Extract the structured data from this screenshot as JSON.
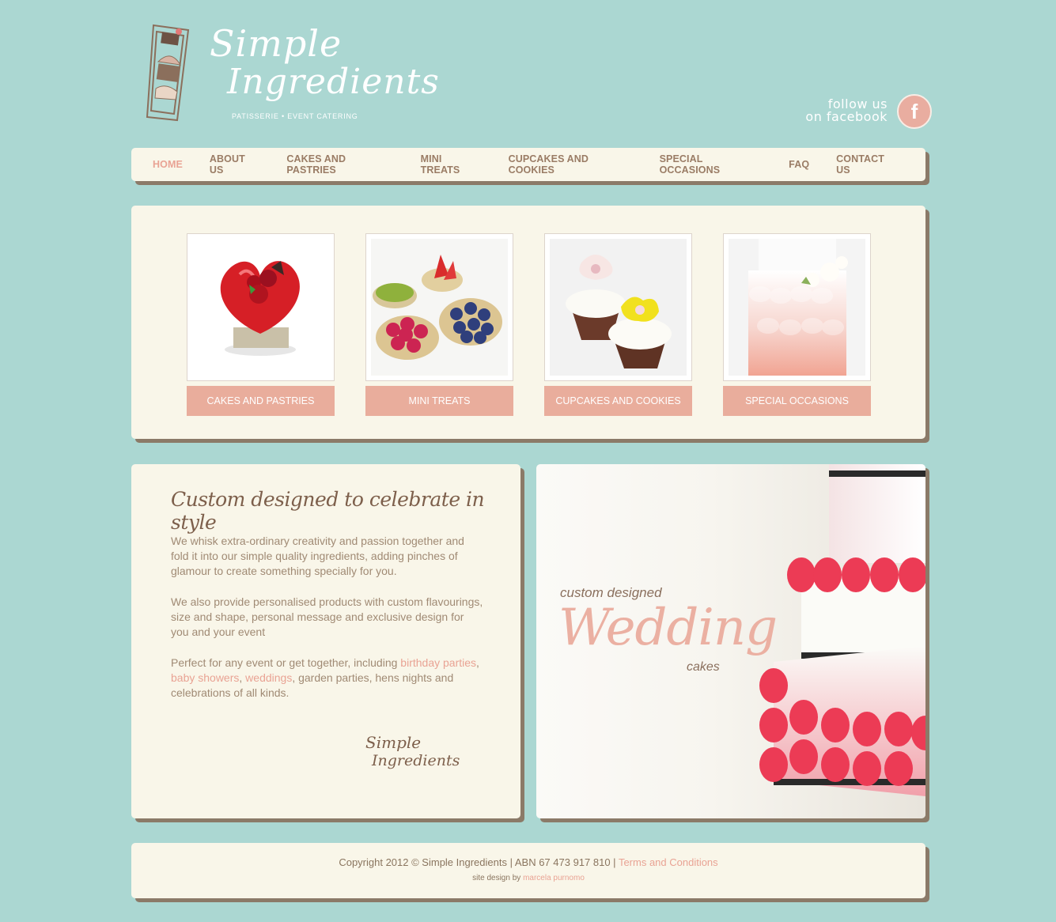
{
  "brand": {
    "name_line1": "Simple",
    "name_line2": "Ingredients",
    "tagline": "PATISSERIE • EVENT CATERING",
    "colors": {
      "background": "#abd7d2",
      "card": "#f9f6e9",
      "accent": "#e9ad9c",
      "brown": "#9a7c65"
    }
  },
  "social": {
    "line1": "follow us",
    "line2": "on facebook",
    "icon": "facebook-icon",
    "icon_glyph": "f"
  },
  "nav": {
    "items": [
      "HOME",
      "ABOUT US",
      "CAKES AND PASTRIES",
      "MINI TREATS",
      "CUPCAKES AND COOKIES",
      "SPECIAL OCCASIONS",
      "FAQ",
      "CONTACT US"
    ],
    "active": "HOME"
  },
  "gallery": {
    "tiles": [
      {
        "label": "CAKES AND PASTRIES"
      },
      {
        "label": "MINI TREATS"
      },
      {
        "label": "CUPCAKES AND COOKIES"
      },
      {
        "label": "SPECIAL OCCASIONS"
      }
    ]
  },
  "intro": {
    "title": "Custom designed to celebrate in style",
    "para1": "We whisk extra-ordinary creativity and passion together and fold it into our simple quality ingredients, adding pinches of glamour to create something specially for you.",
    "para2": "We also provide personalised products with custom flavourings, size and shape, personal message and exclusive design for you and your event",
    "para3_start": "Perfect for any event or get together, including ",
    "link_birthday": "birthday parties",
    "sep1": ", ",
    "link_baby": "baby showers",
    "sep2": ", ",
    "link_weddings": "weddings",
    "para3_end": ", garden parties, hens nights and celebrations of all kinds.",
    "signature_line1": "Simple",
    "signature_line2": "Ingredients"
  },
  "wedding": {
    "line1": "custom designed",
    "big": "Wedding",
    "line3": "cakes"
  },
  "footer": {
    "copyright": "Copyright 2012 © Simple Ingredients | ABN 67 473 917 810 | ",
    "terms": "Terms and Conditions",
    "credit_prefix": "site design by ",
    "credit_name": "marcela purnomo"
  }
}
